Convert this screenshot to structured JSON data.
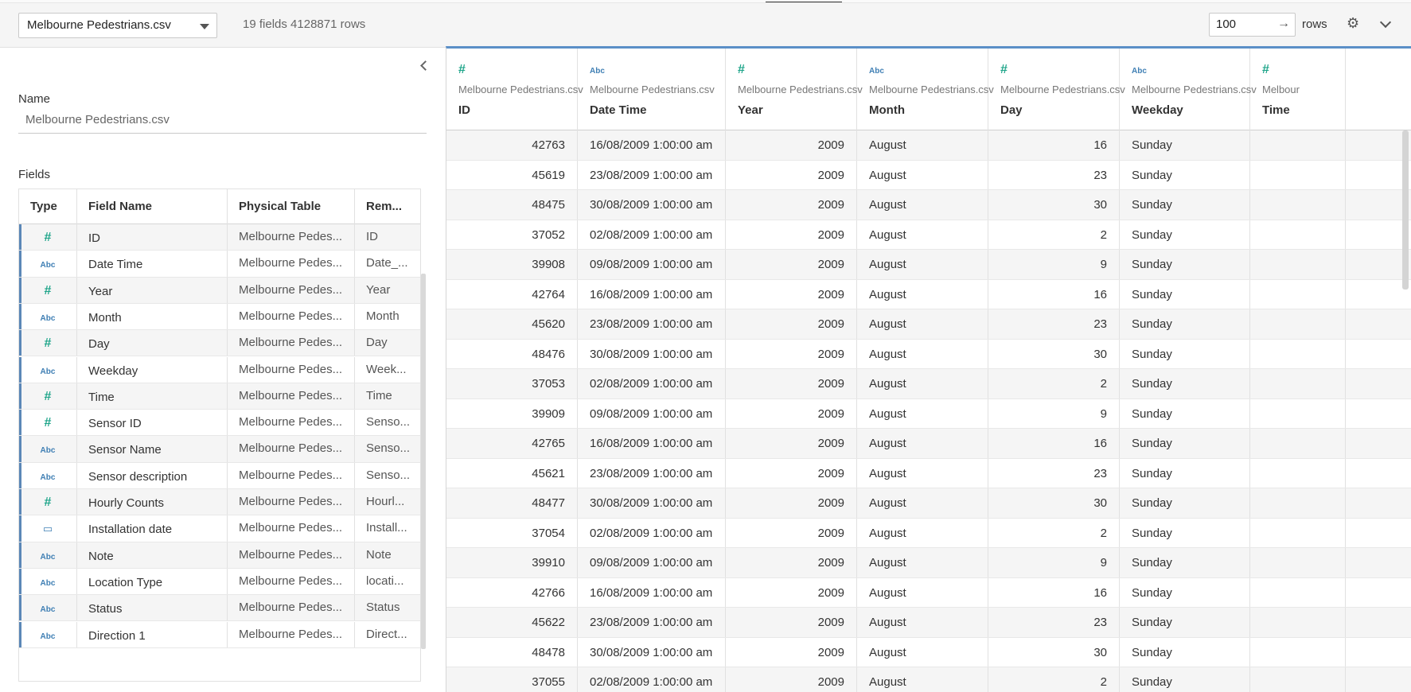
{
  "toolbar": {
    "datasource": "Melbourne Pedestrians.csv",
    "summary": "19 fields 4128871 rows",
    "rows_value": "100",
    "rows_label": "rows"
  },
  "details": {
    "name_label": "Name",
    "name_value": "Melbourne Pedestrians.csv",
    "fields_label": "Fields"
  },
  "fields_table": {
    "headers": [
      "Type",
      "Field Name",
      "Physical Table",
      "Rem..."
    ],
    "rows": [
      {
        "type": "#",
        "name": "ID",
        "table": "Melbourne Pedes...",
        "remote": "ID"
      },
      {
        "type": "Abc",
        "name": "Date Time",
        "table": "Melbourne Pedes...",
        "remote": "Date_..."
      },
      {
        "type": "#",
        "name": "Year",
        "table": "Melbourne Pedes...",
        "remote": "Year"
      },
      {
        "type": "Abc",
        "name": "Month",
        "table": "Melbourne Pedes...",
        "remote": "Month"
      },
      {
        "type": "#",
        "name": "Day",
        "table": "Melbourne Pedes...",
        "remote": "Day"
      },
      {
        "type": "Abc",
        "name": "Weekday",
        "table": "Melbourne Pedes...",
        "remote": "Week..."
      },
      {
        "type": "#",
        "name": "Time",
        "table": "Melbourne Pedes...",
        "remote": "Time"
      },
      {
        "type": "#",
        "name": "Sensor ID",
        "table": "Melbourne Pedes...",
        "remote": "Senso..."
      },
      {
        "type": "Abc",
        "name": "Sensor Name",
        "table": "Melbourne Pedes...",
        "remote": "Senso..."
      },
      {
        "type": "Abc",
        "name": "Sensor description",
        "table": "Melbourne Pedes...",
        "remote": "Senso..."
      },
      {
        "type": "#",
        "name": "Hourly Counts",
        "table": "Melbourne Pedes...",
        "remote": "Hourl..."
      },
      {
        "type": "date",
        "name": "Installation date",
        "table": "Melbourne Pedes...",
        "remote": "Install..."
      },
      {
        "type": "Abc",
        "name": "Note",
        "table": "Melbourne Pedes...",
        "remote": "Note"
      },
      {
        "type": "Abc",
        "name": "Location Type",
        "table": "Melbourne Pedes...",
        "remote": "locati..."
      },
      {
        "type": "Abc",
        "name": "Status",
        "table": "Melbourne Pedes...",
        "remote": "Status"
      },
      {
        "type": "Abc",
        "name": "Direction 1",
        "table": "Melbourne Pedes...",
        "remote": "Direct..."
      }
    ]
  },
  "grid": {
    "columns": [
      {
        "type": "#",
        "source": "Melbourne Pedestrians.csv",
        "name": "ID"
      },
      {
        "type": "Abc",
        "source": "Melbourne Pedestrians.csv",
        "name": "Date Time"
      },
      {
        "type": "#",
        "source": "Melbourne Pedestrians.csv",
        "name": "Year"
      },
      {
        "type": "Abc",
        "source": "Melbourne Pedestrians.csv",
        "name": "Month"
      },
      {
        "type": "#",
        "source": "Melbourne Pedestrians.csv",
        "name": "Day"
      },
      {
        "type": "Abc",
        "source": "Melbourne Pedestrians.csv",
        "name": "Weekday"
      },
      {
        "type": "#",
        "source": "Melbour",
        "name": "Time"
      }
    ],
    "rows": [
      [
        "42763",
        "16/08/2009 1:00:00 am",
        "2009",
        "August",
        "16",
        "Sunday"
      ],
      [
        "45619",
        "23/08/2009 1:00:00 am",
        "2009",
        "August",
        "23",
        "Sunday"
      ],
      [
        "48475",
        "30/08/2009 1:00:00 am",
        "2009",
        "August",
        "30",
        "Sunday"
      ],
      [
        "37052",
        "02/08/2009 1:00:00 am",
        "2009",
        "August",
        "2",
        "Sunday"
      ],
      [
        "39908",
        "09/08/2009 1:00:00 am",
        "2009",
        "August",
        "9",
        "Sunday"
      ],
      [
        "42764",
        "16/08/2009 1:00:00 am",
        "2009",
        "August",
        "16",
        "Sunday"
      ],
      [
        "45620",
        "23/08/2009 1:00:00 am",
        "2009",
        "August",
        "23",
        "Sunday"
      ],
      [
        "48476",
        "30/08/2009 1:00:00 am",
        "2009",
        "August",
        "30",
        "Sunday"
      ],
      [
        "37053",
        "02/08/2009 1:00:00 am",
        "2009",
        "August",
        "2",
        "Sunday"
      ],
      [
        "39909",
        "09/08/2009 1:00:00 am",
        "2009",
        "August",
        "9",
        "Sunday"
      ],
      [
        "42765",
        "16/08/2009 1:00:00 am",
        "2009",
        "August",
        "16",
        "Sunday"
      ],
      [
        "45621",
        "23/08/2009 1:00:00 am",
        "2009",
        "August",
        "23",
        "Sunday"
      ],
      [
        "48477",
        "30/08/2009 1:00:00 am",
        "2009",
        "August",
        "30",
        "Sunday"
      ],
      [
        "37054",
        "02/08/2009 1:00:00 am",
        "2009",
        "August",
        "2",
        "Sunday"
      ],
      [
        "39910",
        "09/08/2009 1:00:00 am",
        "2009",
        "August",
        "9",
        "Sunday"
      ],
      [
        "42766",
        "16/08/2009 1:00:00 am",
        "2009",
        "August",
        "16",
        "Sunday"
      ],
      [
        "45622",
        "23/08/2009 1:00:00 am",
        "2009",
        "August",
        "23",
        "Sunday"
      ],
      [
        "48478",
        "30/08/2009 1:00:00 am",
        "2009",
        "August",
        "30",
        "Sunday"
      ],
      [
        "37055",
        "02/08/2009 1:00:00 am",
        "2009",
        "August",
        "2",
        "Sunday"
      ]
    ]
  },
  "icons": {
    "number": "hash-icon",
    "string": "abc-icon",
    "date": "calendar-icon",
    "settings": "gear-icon"
  },
  "colors": {
    "accent": "#5b8fc7",
    "number_icon": "#1fa58a",
    "string_icon": "#3f7fb4"
  }
}
